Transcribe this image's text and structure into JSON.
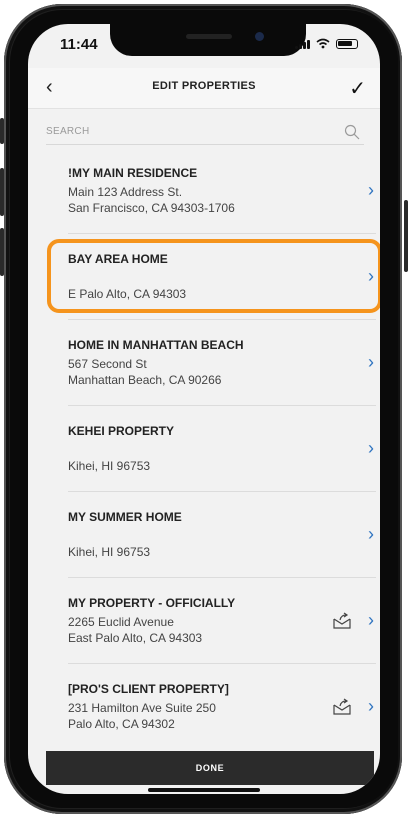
{
  "status": {
    "time": "11:44"
  },
  "nav": {
    "back_icon": "chevron-left-icon",
    "title": "EDIT PROPERTIES",
    "confirm_icon": "checkmark-icon"
  },
  "search": {
    "placeholder": "SEARCH",
    "icon": "search-icon"
  },
  "properties": [
    {
      "name": "!MY MAIN RESIDENCE",
      "line1": "Main 123 Address St.",
      "line2": "San Francisco, CA 94303-1706",
      "shared": false
    },
    {
      "name": "BAY AREA HOME",
      "line1": "",
      "line2": "E Palo Alto, CA 94303",
      "shared": false,
      "highlighted": true
    },
    {
      "name": "HOME IN MANHATTAN BEACH",
      "line1": "567 Second St",
      "line2": "Manhattan Beach, CA 90266",
      "shared": false
    },
    {
      "name": "KEHEI PROPERTY",
      "line1": "",
      "line2": "Kihei, HI 96753",
      "shared": false
    },
    {
      "name": "MY SUMMER HOME",
      "line1": "",
      "line2": "Kihei, HI 96753",
      "shared": false
    },
    {
      "name": "MY PROPERTY - OFFICIALLY",
      "line1": "2265 Euclid Avenue",
      "line2": "East Palo Alto, CA 94303",
      "shared": true
    },
    {
      "name": "[PRO'S CLIENT PROPERTY]",
      "line1": "231 Hamilton Ave Suite 250",
      "line2": "Palo Alto, CA 94302",
      "shared": true
    }
  ],
  "footer": {
    "done_label": "DONE"
  },
  "colors": {
    "highlight": "#f5941d",
    "chevron": "#2f74c0",
    "done_bg": "#2b2b2b"
  }
}
